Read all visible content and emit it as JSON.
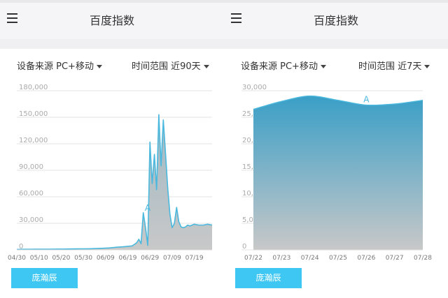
{
  "left": {
    "title": "百度指数",
    "device_filter": "设备来源 PC+移动",
    "time_filter": "时间范围 近90天",
    "button_label": "庞瀚辰"
  },
  "right": {
    "title": "百度指数",
    "device_filter": "设备来源 PC+移动",
    "time_filter": "时间范围 近7天",
    "button_label": "庞瀚辰"
  },
  "colors": {
    "line": "#4bb8de",
    "area_top": "#3a9fc7",
    "area_bottom": "#c8c8c8",
    "button": "#3ec7f2"
  },
  "chart_data": [
    {
      "type": "area",
      "title": "",
      "yticks": [
        0,
        30000,
        60000,
        90000,
        120000,
        150000,
        180000
      ],
      "ytick_labels": [
        "0",
        "30,000",
        "60,000",
        "90,000",
        "120,000",
        "150,000",
        "180,000"
      ],
      "ylim": [
        0,
        180000
      ],
      "xtick_labels": [
        "04/30",
        "05/10",
        "05/20",
        "05/30",
        "06/09",
        "06/19",
        "06/29",
        "07/09",
        "07/19"
      ],
      "x": [
        "04/30",
        "05/03",
        "05/06",
        "05/09",
        "05/12",
        "05/15",
        "05/18",
        "05/21",
        "05/24",
        "05/27",
        "05/30",
        "06/02",
        "06/05",
        "06/08",
        "06/11",
        "06/14",
        "06/17",
        "06/19",
        "06/21",
        "06/23",
        "06/24",
        "06/25",
        "06/26",
        "06/27",
        "06/28",
        "06/29",
        "06/30",
        "07/01",
        "07/02",
        "07/03",
        "07/04",
        "07/05",
        "07/06",
        "07/07",
        "07/08",
        "07/09",
        "07/10",
        "07/11",
        "07/12",
        "07/13",
        "07/14",
        "07/15",
        "07/16",
        "07/17",
        "07/18",
        "07/19",
        "07/21",
        "07/23",
        "07/25",
        "07/27"
      ],
      "values": [
        500,
        600,
        600,
        700,
        700,
        800,
        900,
        900,
        1000,
        1100,
        1200,
        1300,
        1500,
        1800,
        2200,
        3000,
        3500,
        4000,
        4500,
        8000,
        12000,
        7000,
        42000,
        25000,
        5000,
        122000,
        75000,
        108000,
        68000,
        153000,
        95000,
        147000,
        110000,
        70000,
        40000,
        25000,
        30000,
        48000,
        32000,
        26000,
        25000,
        26000,
        28000,
        27000,
        28000,
        29000,
        28000,
        28000,
        29000,
        28000
      ],
      "annotations": [
        {
          "label": "A",
          "x": "06/29"
        }
      ]
    },
    {
      "type": "area",
      "title": "",
      "yticks": [
        0,
        5000,
        10000,
        15000,
        20000,
        25000,
        30000
      ],
      "ytick_labels": [
        "0",
        "5,0",
        "10,",
        "15,",
        "20,",
        "25,",
        "30,000"
      ],
      "ylim": [
        0,
        30000
      ],
      "xtick_labels": [
        "07/22",
        "07/23",
        "07/24",
        "07/25",
        "07/26",
        "07/27",
        "07/28"
      ],
      "x": [
        "07/22",
        "07/23",
        "07/24",
        "07/25",
        "07/26",
        "07/27",
        "07/28"
      ],
      "values": [
        26500,
        28000,
        29000,
        28200,
        27300,
        27500,
        28200
      ],
      "annotations": [
        {
          "label": "A",
          "x": "07/26"
        }
      ]
    }
  ]
}
